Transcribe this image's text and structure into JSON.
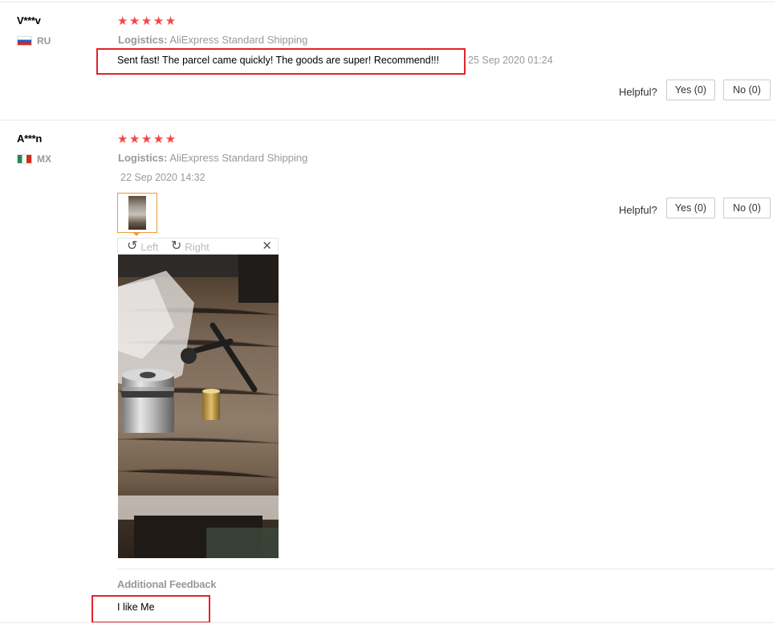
{
  "reviews": [
    {
      "user": "V***v",
      "country": "RU",
      "rating_stars": "★★★★★",
      "rating": 5,
      "logistics_label": "Logistics:",
      "logistics_value": "AliExpress Standard Shipping",
      "text": "Sent fast! The parcel came quickly! The goods are super! Recommend!!!",
      "date": "25 Sep 2020 01:24",
      "helpful_label": "Helpful?",
      "yes_label": "Yes (0)",
      "no_label": "No (0)"
    },
    {
      "user": "A***n",
      "country": "MX",
      "rating_stars": "★★★★★",
      "rating": 5,
      "logistics_label": "Logistics:",
      "logistics_value": "AliExpress Standard Shipping",
      "date": "22 Sep 2020 14:32",
      "helpful_label": "Helpful?",
      "yes_label": "Yes (0)",
      "no_label": "No (0)",
      "viewer": {
        "rotate_left_label": "Left",
        "rotate_right_label": "Right",
        "rotate_left_icon": "rotate-left-icon",
        "rotate_right_icon": "rotate-right-icon",
        "close_icon": "close-icon"
      },
      "additional_feedback_label": "Additional Feedback",
      "additional_feedback_text": "I like Me"
    }
  ],
  "colors": {
    "star": "#f04848",
    "highlight": "#e2232a",
    "thumb_border": "#f29a38",
    "muted_text": "#999999"
  }
}
